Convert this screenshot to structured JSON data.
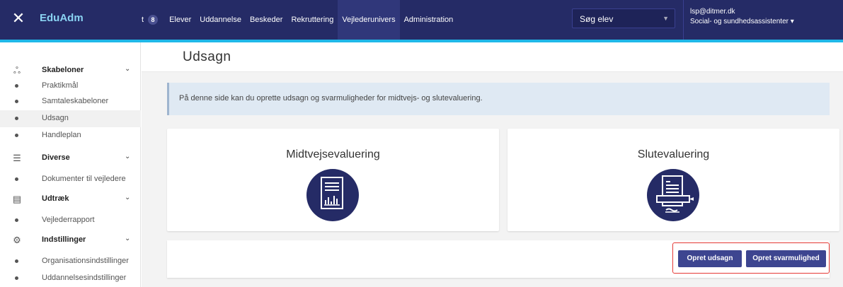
{
  "app": {
    "brand": "EduAdm",
    "close_glyph": "✕"
  },
  "nav": {
    "cut_label": "t",
    "badge": "8",
    "items": [
      {
        "label": "Elever",
        "active": false
      },
      {
        "label": "Uddannelse",
        "active": false
      },
      {
        "label": "Beskeder",
        "active": false
      },
      {
        "label": "Rekruttering",
        "active": false
      },
      {
        "label": "Vejlederunivers",
        "active": true
      },
      {
        "label": "Administration",
        "active": false
      }
    ]
  },
  "search": {
    "value": "Søg elev"
  },
  "user": {
    "email": "lsp@ditmer.dk",
    "role": "Social- og sundhedsassistenter"
  },
  "sidebar": {
    "items": [
      {
        "type": "header",
        "label": "Skabeloner",
        "icon": "people-icon",
        "glyph": "ஃ"
      },
      {
        "type": "item",
        "label": "Praktikmål"
      },
      {
        "type": "item",
        "label": "Samtaleskabeloner"
      },
      {
        "type": "item",
        "label": "Udsagn",
        "active": true
      },
      {
        "type": "item",
        "label": "Handleplan"
      },
      {
        "type": "header",
        "label": "Diverse",
        "icon": "list-icon",
        "glyph": "☰"
      },
      {
        "type": "item",
        "label": "Dokumenter til vejledere"
      },
      {
        "type": "header",
        "label": "Udtræk",
        "icon": "document-icon",
        "glyph": "▤"
      },
      {
        "type": "item",
        "label": "Vejlederrapport"
      },
      {
        "type": "header",
        "label": "Indstillinger",
        "icon": "settings-icon",
        "glyph": "⚙"
      },
      {
        "type": "item",
        "label": "Organisationsindstillinger"
      },
      {
        "type": "item",
        "label": "Uddannelsesindstillinger"
      }
    ]
  },
  "main": {
    "title": "Udsagn",
    "info": "På denne side kan du oprette udsagn og svarmuligheder for midtvejs- og slutevaluering.",
    "cards": [
      {
        "title": "Midtvejsevaluering",
        "icon": "report-chart-icon"
      },
      {
        "title": "Slutevaluering",
        "icon": "document-sign-icon"
      }
    ],
    "buttons": {
      "create_statement": "Opret udsagn",
      "create_option": "Opret svarmulighed"
    }
  },
  "colors": {
    "topbar": "#252b66",
    "accent": "#1fb8e8",
    "button": "#3d4590",
    "highlight": "#e53935"
  }
}
